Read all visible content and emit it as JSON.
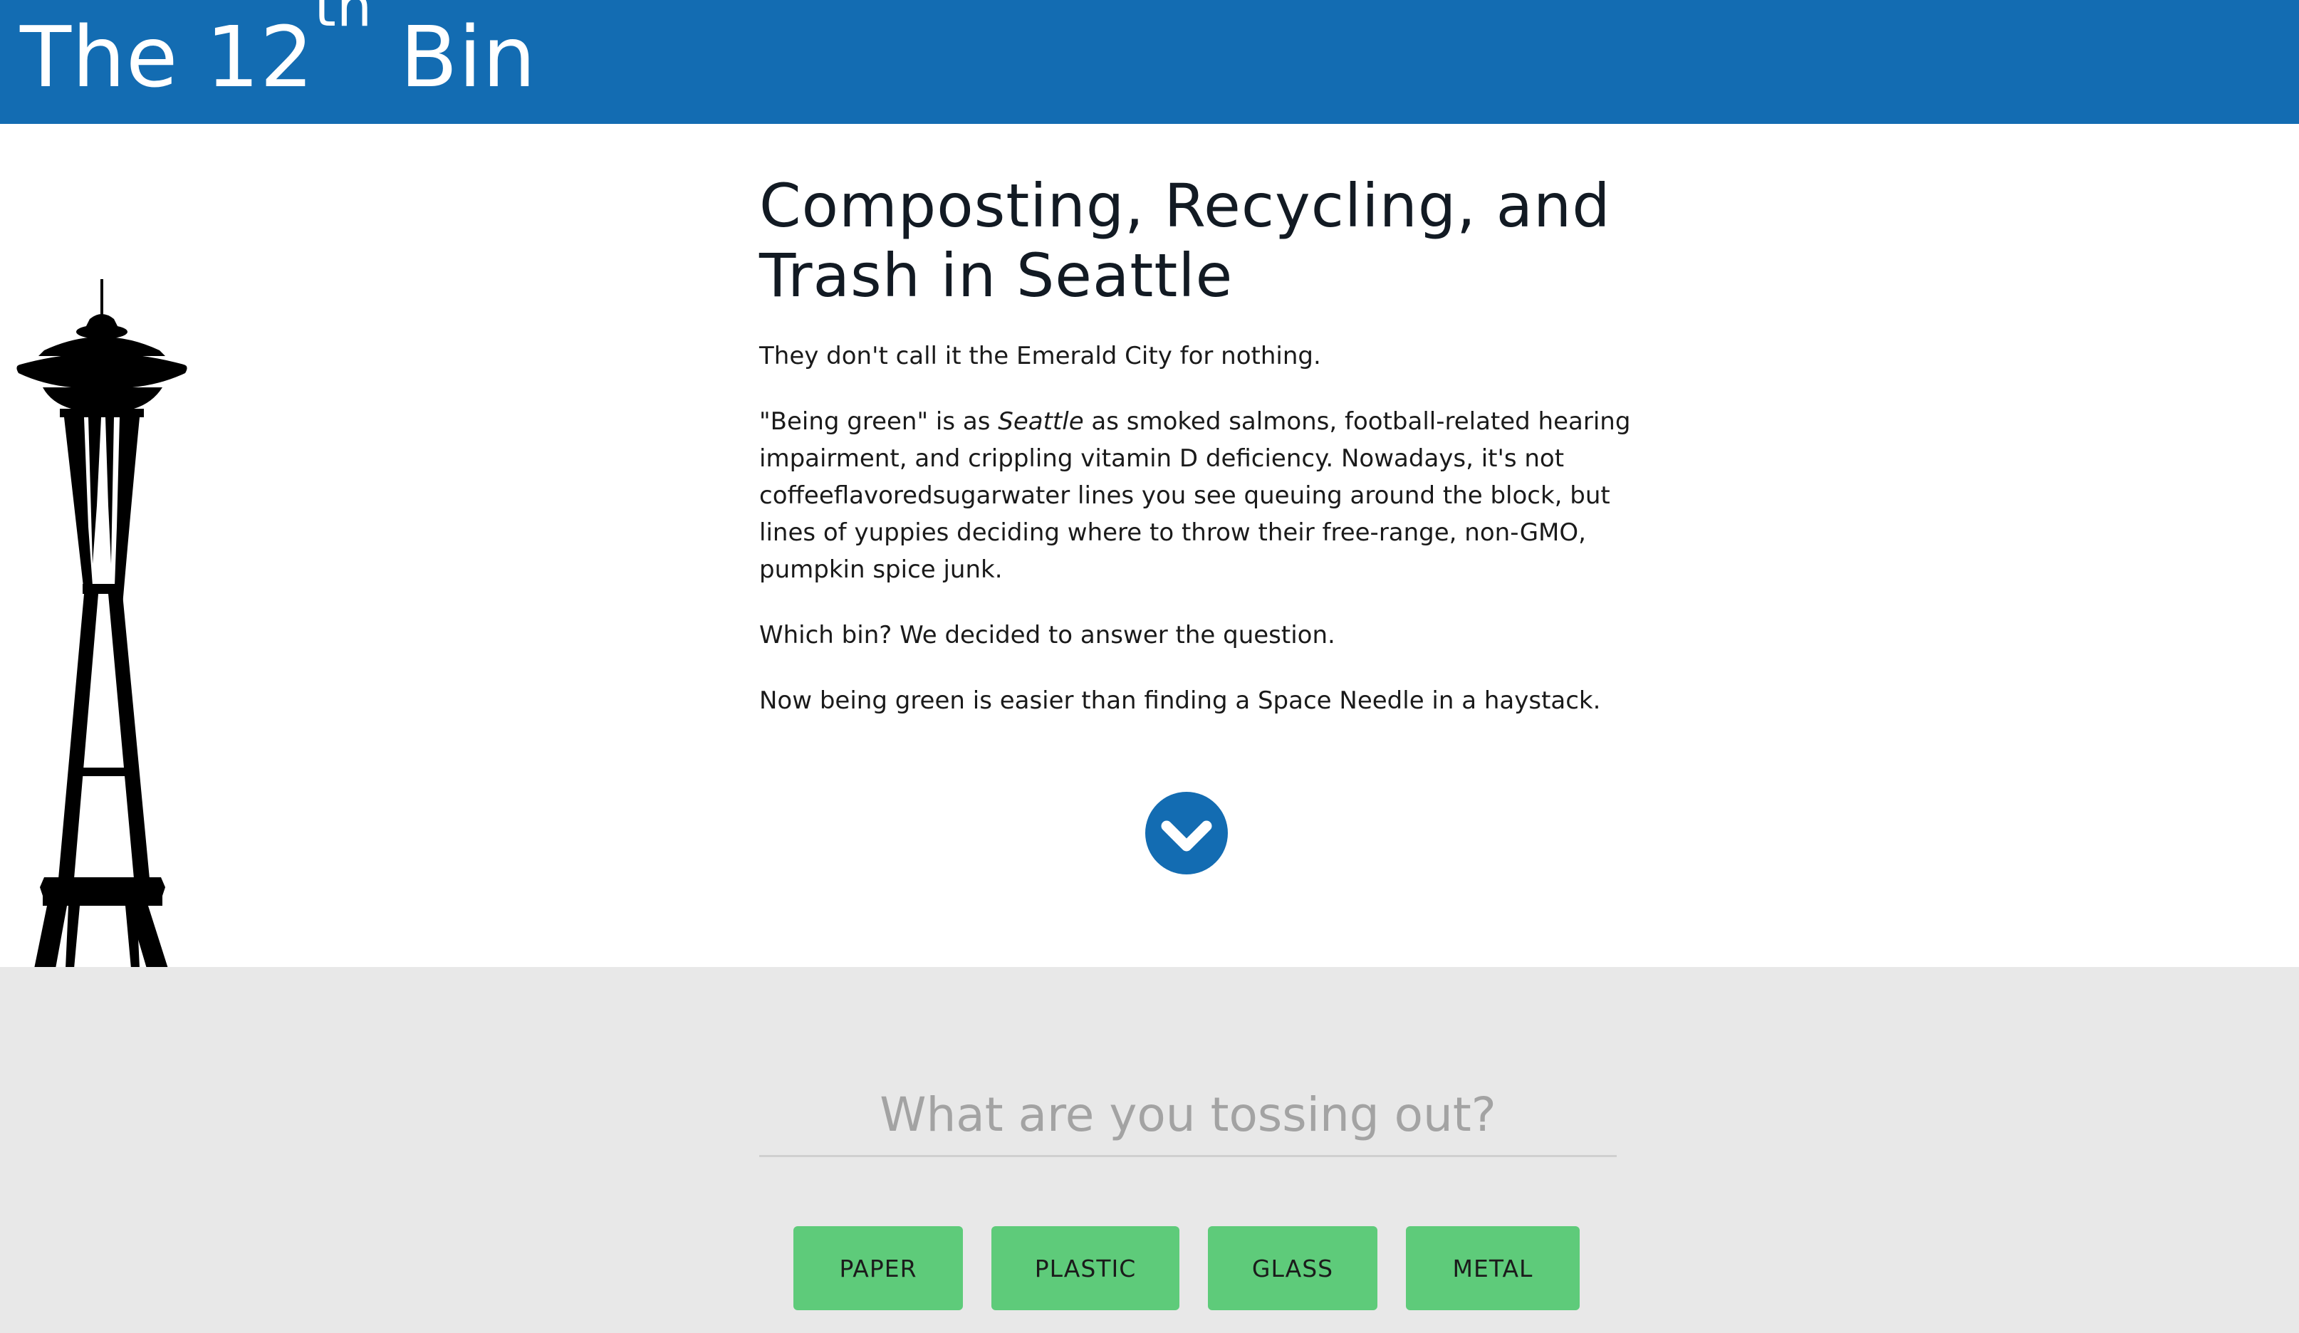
{
  "header": {
    "logo_prefix": "The 12",
    "logo_sup": "th",
    "logo_suffix": " Bin",
    "background_color": "#136cb2"
  },
  "intro": {
    "title": "Composting, Recycling, and Trash in Seattle",
    "paragraph1": "They don't call it the Emerald City for nothing.",
    "paragraph2_start": "\"Being green\" is as ",
    "paragraph2_emphasis": "Seattle",
    "paragraph2_end": " as smoked salmons, football-related hearing impairment, and crippling vitamin D deficiency. Nowadays, it's not coffeeflavoredsugarwater lines you see queuing around the block, but lines of yuppies deciding where to throw their free-range, non-GMO, pumpkin spice junk.",
    "paragraph3": "Which bin? We decided to answer the question.",
    "paragraph4": "Now being green is easier than finding a Space Needle in a haystack."
  },
  "scroll_button": {
    "icon": "chevron-down-icon"
  },
  "decoration": {
    "icon": "space-needle-silhouette"
  },
  "search": {
    "placeholder": "What are you tossing out?",
    "value": ""
  },
  "categories": [
    "PAPER",
    "PLASTIC",
    "GLASS",
    "METAL"
  ],
  "colors": {
    "accent_blue": "#136cb2",
    "button_green": "#5ecb7a",
    "band_gray": "#e8e8e8"
  }
}
